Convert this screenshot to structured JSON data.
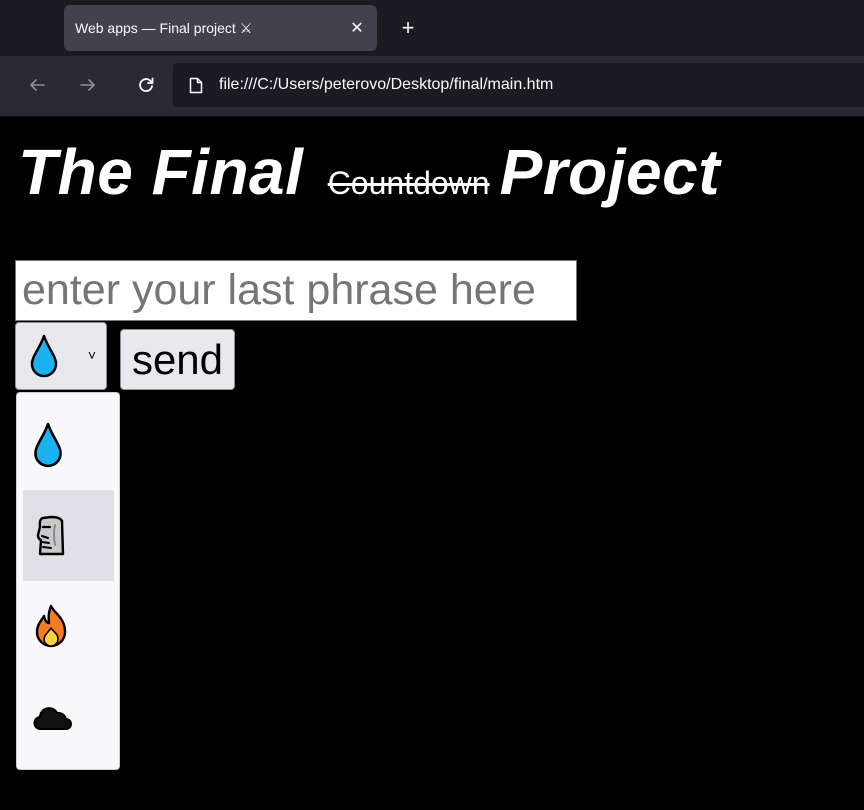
{
  "browser": {
    "tab_title": "Web apps — Final project ⚔",
    "tab_close_glyph": "✕",
    "new_tab_glyph": "+",
    "url": "file:///C:/Users/peterovo/Desktop/final/main.htm",
    "back_glyph": "←",
    "forward_glyph": "→"
  },
  "page": {
    "heading_part1": "The Final",
    "heading_struck": "Countdown",
    "heading_part2": "Project",
    "input_placeholder": "enter your last phrase here",
    "input_value": "",
    "select_chevron": "˅",
    "send_label": "send"
  },
  "select": {
    "selected": "droplet-icon",
    "options": [
      {
        "icon": "droplet-icon",
        "hovered": false
      },
      {
        "icon": "moai-icon",
        "hovered": true
      },
      {
        "icon": "fire-icon",
        "hovered": false
      },
      {
        "icon": "cloud-icon",
        "hovered": false
      }
    ]
  },
  "colors": {
    "page_background": "#000000",
    "tab_background": "#42414d",
    "toolbar_background": "#2b2a33",
    "droplet_blue": "#1ab2f0",
    "option_hover": "#e0e0e6"
  }
}
